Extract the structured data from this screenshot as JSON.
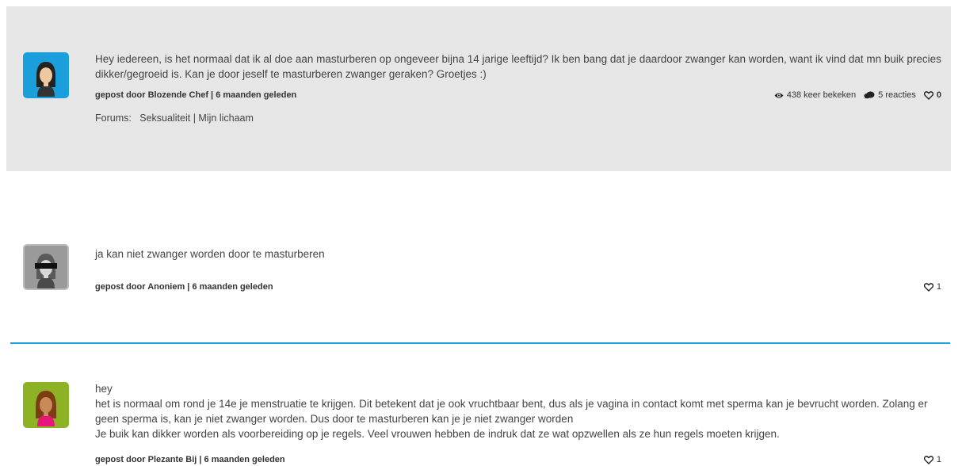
{
  "original_post": {
    "text": "Hey iedereen, is het normaal dat ik al doe aan masturberen op ongeveer bijna 14 jarige leeftijd? Ik ben bang dat je daardoor zwanger kan worden, want ik vind dat mn buik precies dikker/gegroeid is. Kan je door jeself te masturberen zwanger geraken? Groetjes :)",
    "meta": "gepost door Blozende Chef | 6 maanden geleden",
    "views": "438 keer bekeken",
    "reactions": "5 reacties",
    "likes": "0",
    "forums_label": "Forums:",
    "forum_1": "Seksualiteit",
    "forum_separator": "|",
    "forum_2": "Mijn lichaam"
  },
  "replies": [
    {
      "text": "ja kan niet zwanger worden door te masturberen",
      "meta": "gepost door Anoniem | 6 maanden geleden",
      "likes": "1"
    },
    {
      "greeting": "hey",
      "paragraph_1": "het is normaal om rond je 14e je menstruatie te krijgen. Dit betekent dat je ook vruchtbaar bent, dus als je vagina in contact komt met sperma kan je bevrucht worden. Zolang er geen sperma is, kan je niet zwanger worden. Dus door te masturberen kan je je niet zwanger worden",
      "paragraph_2": "Je buik kan dikker worden als voorbereiding op je regels. Veel vrouwen hebben de indruk dat ze wat opzwellen als ze hun regels moeten krijgen.",
      "meta": "gepost door Plezante Bij | 6 maanden geleden",
      "likes": "1"
    }
  ],
  "colors": {
    "accent": "#1a9fdc",
    "post_background": "#e6e6e6",
    "avatar_green": "#8db324",
    "avatar_grey": "#9a9a9a"
  },
  "icons": {
    "views": "eye-icon",
    "reactions": "speech-bubble-icon",
    "likes": "heart-outline-icon"
  }
}
